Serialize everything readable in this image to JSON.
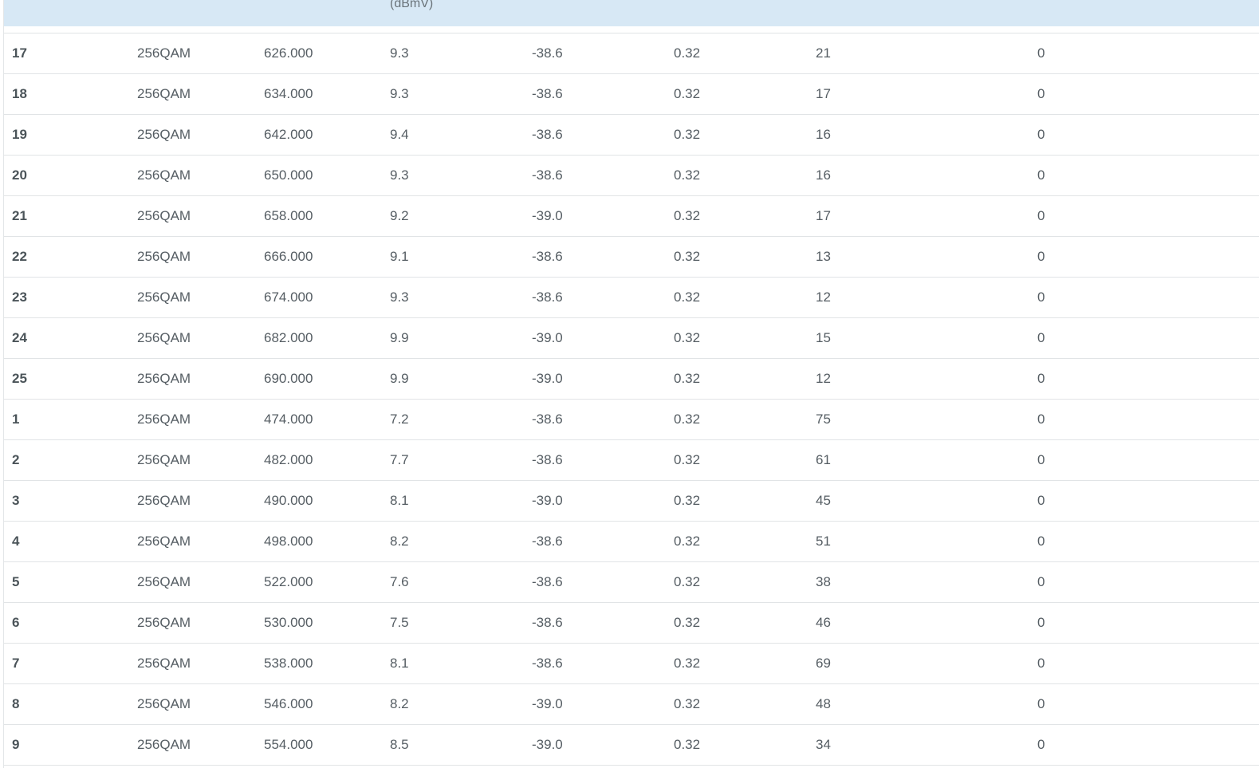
{
  "table": {
    "header_partial_unit": "(dBmV)",
    "rows": [
      {
        "channel": "17",
        "modulation": "256QAM",
        "frequency": "626.000",
        "power": "9.3",
        "snr": "-38.6",
        "col6": "0.32",
        "corrected": "21",
        "uncorrectable": "0"
      },
      {
        "channel": "18",
        "modulation": "256QAM",
        "frequency": "634.000",
        "power": "9.3",
        "snr": "-38.6",
        "col6": "0.32",
        "corrected": "17",
        "uncorrectable": "0"
      },
      {
        "channel": "19",
        "modulation": "256QAM",
        "frequency": "642.000",
        "power": "9.4",
        "snr": "-38.6",
        "col6": "0.32",
        "corrected": "16",
        "uncorrectable": "0"
      },
      {
        "channel": "20",
        "modulation": "256QAM",
        "frequency": "650.000",
        "power": "9.3",
        "snr": "-38.6",
        "col6": "0.32",
        "corrected": "16",
        "uncorrectable": "0"
      },
      {
        "channel": "21",
        "modulation": "256QAM",
        "frequency": "658.000",
        "power": "9.2",
        "snr": "-39.0",
        "col6": "0.32",
        "corrected": "17",
        "uncorrectable": "0"
      },
      {
        "channel": "22",
        "modulation": "256QAM",
        "frequency": "666.000",
        "power": "9.1",
        "snr": "-38.6",
        "col6": "0.32",
        "corrected": "13",
        "uncorrectable": "0"
      },
      {
        "channel": "23",
        "modulation": "256QAM",
        "frequency": "674.000",
        "power": "9.3",
        "snr": "-38.6",
        "col6": "0.32",
        "corrected": "12",
        "uncorrectable": "0"
      },
      {
        "channel": "24",
        "modulation": "256QAM",
        "frequency": "682.000",
        "power": "9.9",
        "snr": "-39.0",
        "col6": "0.32",
        "corrected": "15",
        "uncorrectable": "0"
      },
      {
        "channel": "25",
        "modulation": "256QAM",
        "frequency": "690.000",
        "power": "9.9",
        "snr": "-39.0",
        "col6": "0.32",
        "corrected": "12",
        "uncorrectable": "0"
      },
      {
        "channel": "1",
        "modulation": "256QAM",
        "frequency": "474.000",
        "power": "7.2",
        "snr": "-38.6",
        "col6": "0.32",
        "corrected": "75",
        "uncorrectable": "0"
      },
      {
        "channel": "2",
        "modulation": "256QAM",
        "frequency": "482.000",
        "power": "7.7",
        "snr": "-38.6",
        "col6": "0.32",
        "corrected": "61",
        "uncorrectable": "0"
      },
      {
        "channel": "3",
        "modulation": "256QAM",
        "frequency": "490.000",
        "power": "8.1",
        "snr": "-39.0",
        "col6": "0.32",
        "corrected": "45",
        "uncorrectable": "0"
      },
      {
        "channel": "4",
        "modulation": "256QAM",
        "frequency": "498.000",
        "power": "8.2",
        "snr": "-38.6",
        "col6": "0.32",
        "corrected": "51",
        "uncorrectable": "0"
      },
      {
        "channel": "5",
        "modulation": "256QAM",
        "frequency": "522.000",
        "power": "7.6",
        "snr": "-38.6",
        "col6": "0.32",
        "corrected": "38",
        "uncorrectable": "0"
      },
      {
        "channel": "6",
        "modulation": "256QAM",
        "frequency": "530.000",
        "power": "7.5",
        "snr": "-38.6",
        "col6": "0.32",
        "corrected": "46",
        "uncorrectable": "0"
      },
      {
        "channel": "7",
        "modulation": "256QAM",
        "frequency": "538.000",
        "power": "8.1",
        "snr": "-38.6",
        "col6": "0.32",
        "corrected": "69",
        "uncorrectable": "0"
      },
      {
        "channel": "8",
        "modulation": "256QAM",
        "frequency": "546.000",
        "power": "8.2",
        "snr": "-39.0",
        "col6": "0.32",
        "corrected": "48",
        "uncorrectable": "0"
      },
      {
        "channel": "9",
        "modulation": "256QAM",
        "frequency": "554.000",
        "power": "8.5",
        "snr": "-39.0",
        "col6": "0.32",
        "corrected": "34",
        "uncorrectable": "0"
      }
    ]
  },
  "colors": {
    "header_background": "#d7e8f5",
    "row_divider": "#e1e4e6",
    "text": "#555d63"
  }
}
